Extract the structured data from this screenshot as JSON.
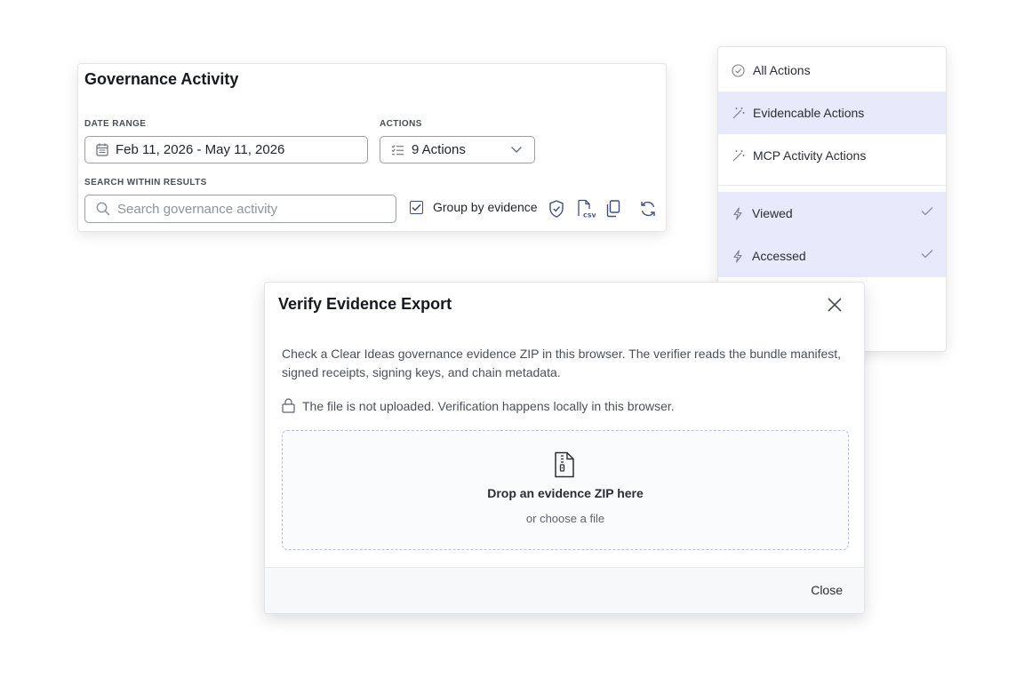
{
  "governance": {
    "title": "Governance Activity",
    "date_range": {
      "label": "DATE RANGE",
      "value": "Feb 11, 2026 - May 11, 2026"
    },
    "actions": {
      "label": "ACTIONS",
      "value": "9 Actions"
    },
    "search": {
      "label": "SEARCH WITHIN RESULTS",
      "placeholder": "Search governance activity"
    },
    "group_by": {
      "label": "Group by evidence",
      "checked": true
    },
    "toolbar_icons": [
      "shield-check-icon",
      "csv-file-icon",
      "copy-icon",
      "refresh-icon"
    ]
  },
  "actions_menu": {
    "items": [
      {
        "label": "All Actions",
        "icon": "check-circle-icon",
        "selected": false
      },
      {
        "label": "Evidencable Actions",
        "icon": "magic-wand-icon",
        "selected": true
      },
      {
        "label": "MCP Activity Actions",
        "icon": "magic-wand-icon",
        "selected": false
      },
      {
        "label": "Viewed",
        "icon": "lightning-icon",
        "selected": true,
        "checked": true
      },
      {
        "label": "Accessed",
        "icon": "lightning-icon",
        "selected": true,
        "checked": true
      }
    ]
  },
  "modal": {
    "title": "Verify Evidence Export",
    "description": "Check a Clear Ideas governance evidence ZIP in this browser. The verifier reads the bundle manifest, signed receipts, signing keys, and chain metadata.",
    "privacy_note": "The file is not uploaded. Verification happens locally in this browser.",
    "dropzone": {
      "title": "Drop an evidence ZIP here",
      "subtitle": "or choose a file"
    },
    "close_label": "Close"
  },
  "colors": {
    "accent": "#3b4b8c",
    "menu_selected_bg": "#e8eafb",
    "dropzone_border": "#b9bfe0"
  }
}
